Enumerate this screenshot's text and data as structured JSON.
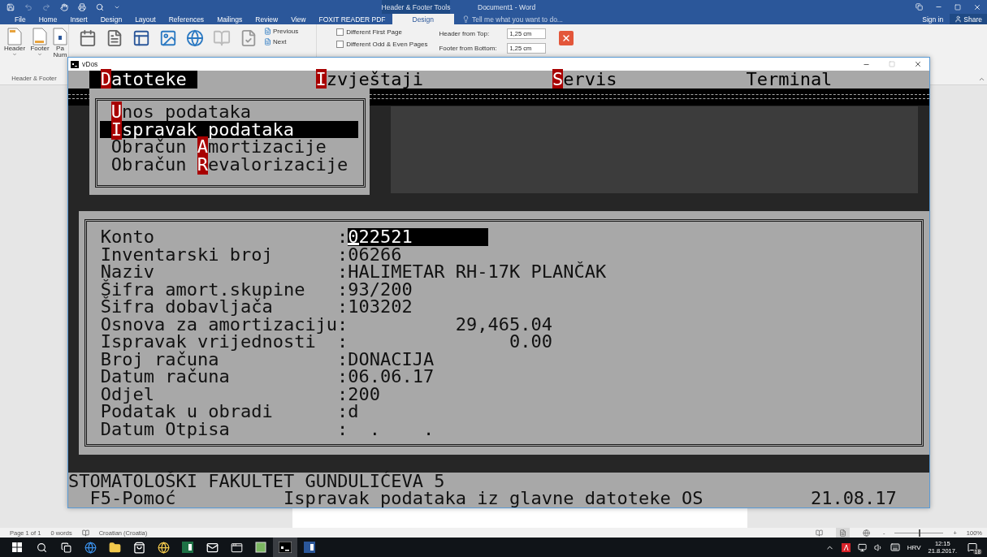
{
  "word": {
    "context_group": "Header & Footer Tools",
    "title": "Document1 - Word",
    "tabs": [
      {
        "label": "File",
        "selected": false
      },
      {
        "label": "Home",
        "selected": false
      },
      {
        "label": "Insert",
        "selected": false
      },
      {
        "label": "Design",
        "selected": false
      },
      {
        "label": "Layout",
        "selected": false
      },
      {
        "label": "References",
        "selected": false
      },
      {
        "label": "Mailings",
        "selected": false
      },
      {
        "label": "Review",
        "selected": false
      },
      {
        "label": "View",
        "selected": false
      },
      {
        "label": "FOXIT READER PDF",
        "selected": false
      },
      {
        "label": "Design",
        "selected": true
      }
    ],
    "tell_me": {
      "placeholder": "Tell me what you want to do..."
    },
    "sign_in": "Sign in",
    "share": "Share",
    "ribbon": {
      "header_footer": {
        "buttons": [
          {
            "label": "Header",
            "kind": "header"
          },
          {
            "label": "Footer",
            "kind": "footer"
          },
          {
            "label": "Pa",
            "label_2": "Num",
            "kind": "page"
          }
        ],
        "label": "Header & Footer"
      },
      "navigation": [
        {
          "label": "Previous",
          "disabled": false
        },
        {
          "label": "Next",
          "disabled": false
        }
      ],
      "options": [
        {
          "label": "Different First Page",
          "checked": false
        },
        {
          "label": "Different Odd & Even Pages",
          "checked": false
        }
      ],
      "position": [
        {
          "label": "Header from Top:",
          "value": "1,25 cm"
        },
        {
          "label": "Footer from Bottom:",
          "value": "1,25 cm"
        }
      ]
    },
    "status_bar": {
      "page": "Page 1 of 1",
      "words": "0 words",
      "language": "Croatian (Croatia)",
      "zoom_out": "-",
      "zoom_in": "+",
      "zoom": {
        "level": 0.5
      },
      "zoom_reading": "100%"
    }
  },
  "dos_window": {
    "title": "vDos",
    "menu": [
      {
        "key": "D",
        "after": "atoteke",
        "selected": true
      },
      {
        "key": "I",
        "after": "zvještaji",
        "selected": false
      },
      {
        "key": "S",
        "after": "ervis",
        "selected": false
      },
      {
        "after": "Terminal",
        "selected": false
      }
    ],
    "submenu": [
      {
        "key": "U",
        "after": "nos podataka",
        "selected": false
      },
      {
        "key": "I",
        "after": "spravak podataka",
        "selected": true
      },
      {
        "before": "Obračun ",
        "key": "A",
        "after": "mortizacije",
        "selected": false
      },
      {
        "before": "Obračun ",
        "key": "R",
        "after": "evalorizacije",
        "selected": false
      }
    ],
    "form": [
      {
        "label": "Konto",
        "sep": ":",
        "value": "022521",
        "kind": "text",
        "focused": true
      },
      {
        "label": "Inventarski broj",
        "sep": ":",
        "value": "06266",
        "kind": "text",
        "focused": false
      },
      {
        "label": "Naziv",
        "sep": ":",
        "value": "HALIMETAR RH-17K PLANČAK",
        "kind": "text",
        "focused": false
      },
      {
        "label": "Šifra amort.skupine",
        "sep": ":",
        "value": "93/200",
        "kind": "text",
        "focused": false
      },
      {
        "label": "Šifra dobavljača",
        "sep": ":",
        "value": "103202",
        "kind": "text",
        "focused": false
      },
      {
        "label": "Osnova za amortizaciju",
        "sep": ":",
        "value": "29,465.04",
        "kind": "amount",
        "focused": false
      },
      {
        "label": "Ispravak vrijednosti",
        "sep": ":",
        "value": "0.00",
        "kind": "amount",
        "focused": false
      },
      {
        "label": "Broj računa",
        "sep": ":",
        "value": "DONACIJA",
        "kind": "text",
        "focused": false
      },
      {
        "label": "Datum računa",
        "sep": ":",
        "value": "06.06.17",
        "kind": "text",
        "focused": false
      },
      {
        "label": "Odjel",
        "sep": ":",
        "value": "200",
        "kind": "text",
        "focused": false
      },
      {
        "label": "Podatak u obradi",
        "sep": ":",
        "value": "d",
        "kind": "text",
        "focused": false
      },
      {
        "label": "Datum Otpisa",
        "sep": ":",
        "value": ".    .",
        "kind": "blank_date",
        "focused": false
      }
    ],
    "organization": "STOMATOLOŠKI FAKULTET GUNDULIĆEVA 5",
    "help": "F5-Pomoć",
    "message": "Ispravak podataka iz glavne datoteke OS",
    "date": "21.08.17"
  },
  "taskbar": {
    "apps": [
      {
        "kind": "edge",
        "selected": false
      },
      {
        "kind": "folder",
        "selected": false
      },
      {
        "kind": "store",
        "selected": false
      },
      {
        "kind": "ie",
        "selected": false
      },
      {
        "kind": "excel",
        "selected": false
      },
      {
        "kind": "mail",
        "selected": false
      },
      {
        "kind": "window",
        "selected": false
      },
      {
        "kind": "green",
        "selected": false
      },
      {
        "kind": "console",
        "selected": true
      },
      {
        "kind": "word",
        "selected": false
      }
    ],
    "language": "HRV",
    "time": "12:15",
    "date": "21.8.2017.",
    "notifications": "18"
  }
}
